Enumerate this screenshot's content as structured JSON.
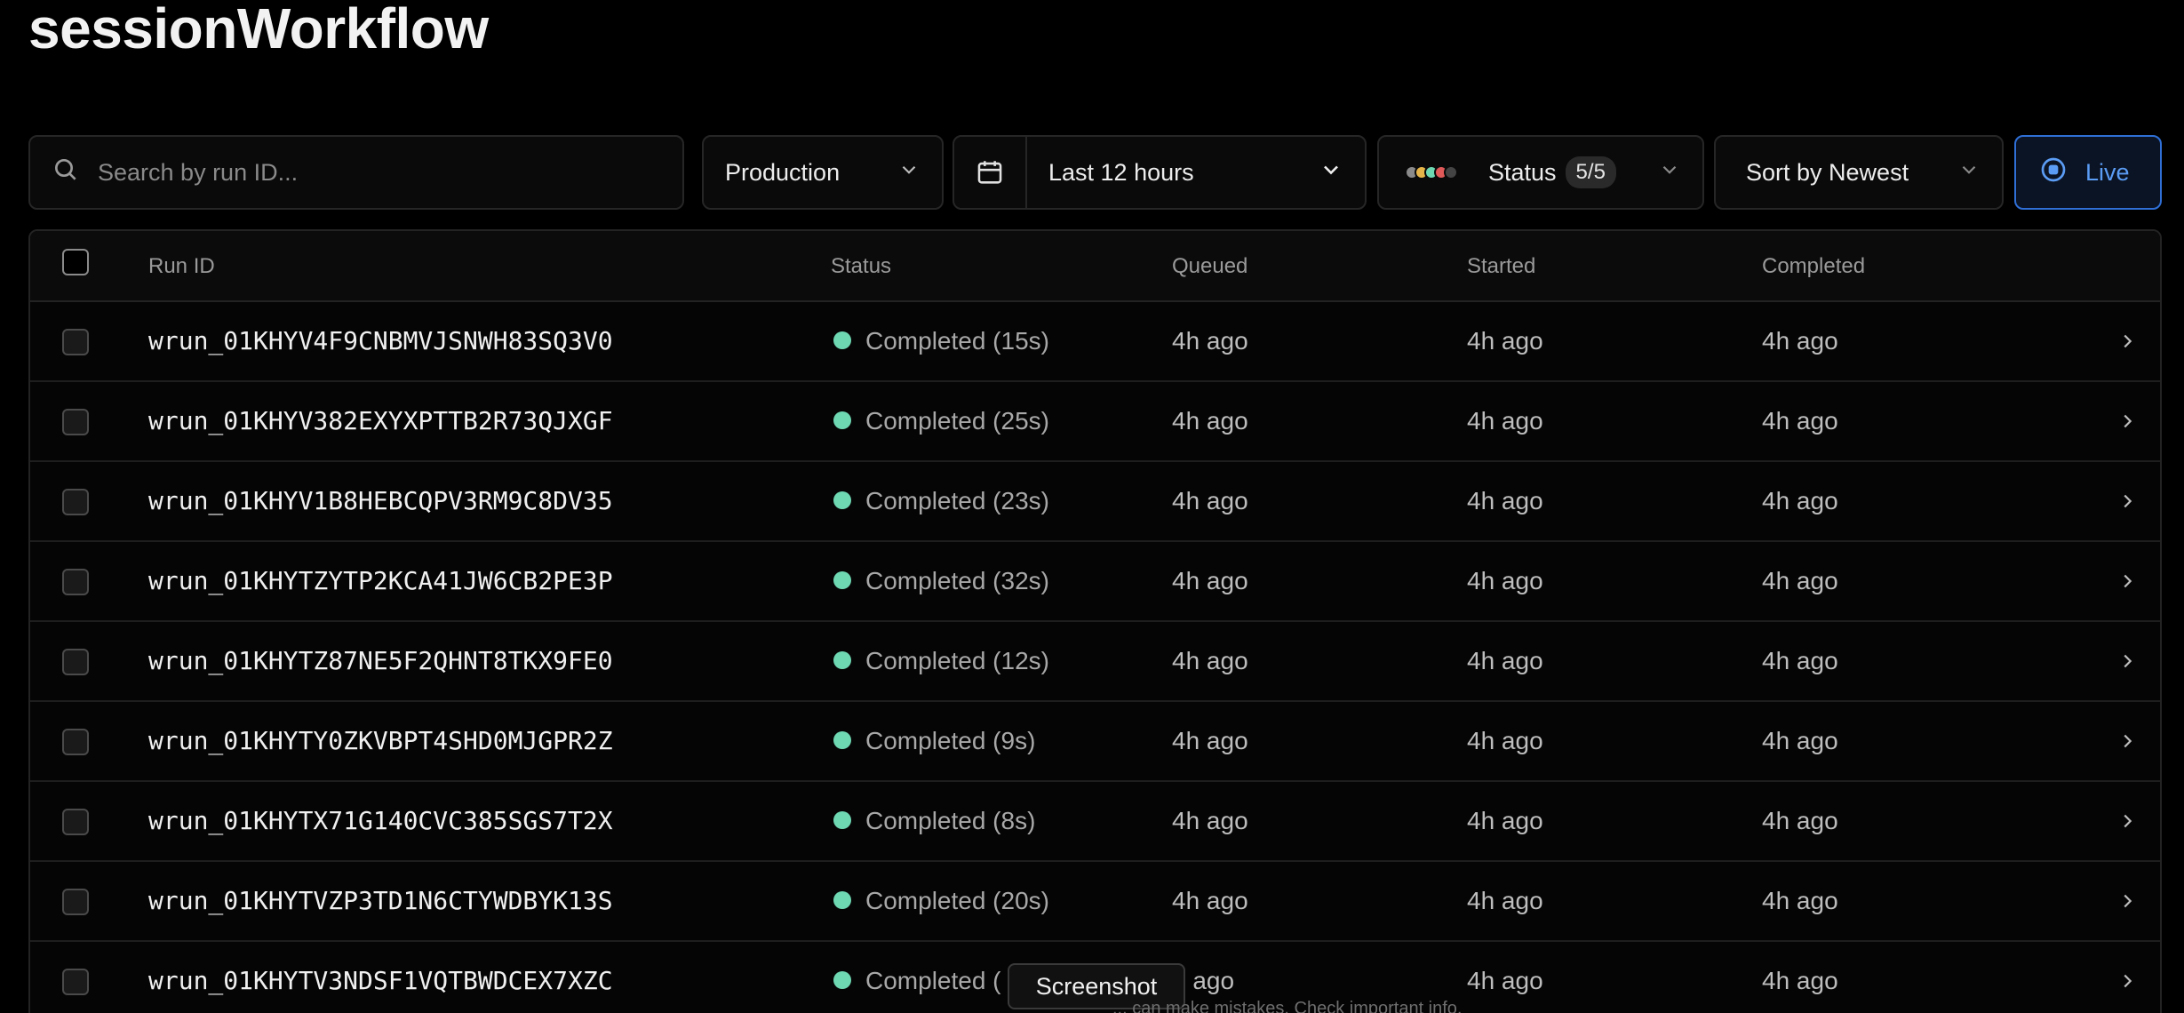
{
  "page": {
    "title": "sessionWorkflow"
  },
  "toolbar": {
    "search_placeholder": "Search by run ID...",
    "environment": "Production",
    "date_range": "Last 12 hours",
    "status_label": "Status",
    "status_count": "5/5",
    "status_colors": [
      "#8a8a8a",
      "#e5b54a",
      "#6ed8b3",
      "#e05a5a",
      "#444444"
    ],
    "sort_label": "Sort by Newest",
    "live_label": "Live"
  },
  "table": {
    "headers": {
      "run_id": "Run ID",
      "status": "Status",
      "queued": "Queued",
      "started": "Started",
      "completed": "Completed"
    },
    "rows": [
      {
        "run_id": "wrun_01KHYV4F9CNBMVJSNWH83SQ3V0",
        "status": "Completed (15s)",
        "queued": "4h ago",
        "started": "4h ago",
        "completed": "4h ago"
      },
      {
        "run_id": "wrun_01KHYV382EXYXPTTB2R73QJXGF",
        "status": "Completed (25s)",
        "queued": "4h ago",
        "started": "4h ago",
        "completed": "4h ago"
      },
      {
        "run_id": "wrun_01KHYV1B8HEBCQPV3RM9C8DV35",
        "status": "Completed (23s)",
        "queued": "4h ago",
        "started": "4h ago",
        "completed": "4h ago"
      },
      {
        "run_id": "wrun_01KHYTZYTP2KCA41JW6CB2PE3P",
        "status": "Completed (32s)",
        "queued": "4h ago",
        "started": "4h ago",
        "completed": "4h ago"
      },
      {
        "run_id": "wrun_01KHYTZ87NE5F2QHNT8TKX9FE0",
        "status": "Completed (12s)",
        "queued": "4h ago",
        "started": "4h ago",
        "completed": "4h ago"
      },
      {
        "run_id": "wrun_01KHYTY0ZKVBPT4SHD0MJGPR2Z",
        "status": "Completed (9s)",
        "queued": "4h ago",
        "started": "4h ago",
        "completed": "4h ago"
      },
      {
        "run_id": "wrun_01KHYTX71G140CVC385SGS7T2X",
        "status": "Completed (8s)",
        "queued": "4h ago",
        "started": "4h ago",
        "completed": "4h ago"
      },
      {
        "run_id": "wrun_01KHYTVZP3TD1N6CTYWDBYK13S",
        "status": "Completed (20s)",
        "queued": "4h ago",
        "started": "4h ago",
        "completed": "4h ago"
      },
      {
        "run_id": "wrun_01KHYTV3NDSF1VQTBWDCEX7XZC",
        "status": "Completed (",
        "queued": "h ago",
        "started": "4h ago",
        "completed": "4h ago"
      }
    ]
  },
  "overlay": {
    "tooltip": "Screenshot",
    "footer_note": "... can make mistakes. Check important info."
  }
}
